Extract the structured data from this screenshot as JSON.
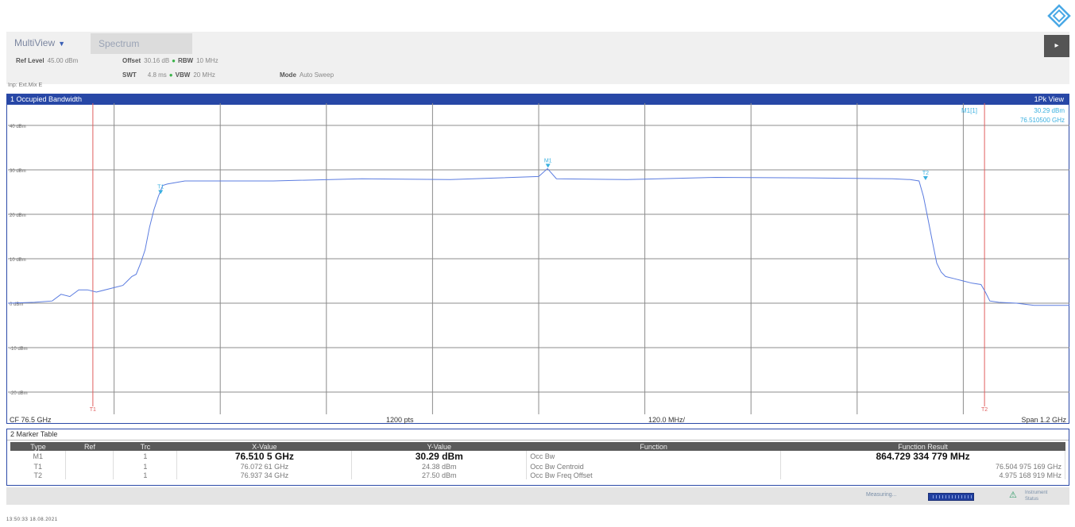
{
  "header": {
    "tab_multiview": "MultiView",
    "tab_spectrum": "Spectrum",
    "ref_level_label": "Ref Level",
    "ref_level_value": "45.00 dBm",
    "offset_label": "Offset",
    "offset_value": "30.16 dB",
    "rbw_label": "RBW",
    "rbw_value": "10 MHz",
    "swt_label": "SWT",
    "swt_value": "4.8 ms",
    "vbw_label": "VBW",
    "vbw_value": "20 MHz",
    "mode_label": "Mode",
    "mode_value": "Auto Sweep",
    "sub_label": "Inp: Ext.Mix E"
  },
  "window1": {
    "title": "1 Occupied Bandwidth",
    "view": "1Pk View",
    "marker_readout_name": "M1[1]",
    "marker_readout_level": "30.29 dBm",
    "marker_readout_freq": "76.510500 GHz"
  },
  "axis": {
    "y_ticks": [
      "40 dBm",
      "30 dBm",
      "20 dBm",
      "10 dBm",
      "0 dBm",
      "-10 dBm",
      "-20 dBm"
    ],
    "cf": "CF 76.5 GHz",
    "points": "1200 pts",
    "div": "120.0 MHz/",
    "span": "Span 1.2 GHz"
  },
  "chart_data": {
    "type": "line",
    "xlabel": "",
    "ylabel": "",
    "xlim": [
      75.9,
      77.1
    ],
    "ylim": [
      -25,
      45
    ],
    "y_ticks": [
      40,
      30,
      20,
      10,
      0,
      -10,
      -20
    ],
    "grid": true,
    "series": [
      {
        "x": [
          75.9,
          75.93,
          75.95,
          75.96,
          75.97,
          75.98,
          75.99,
          76.0,
          76.02,
          76.03,
          76.035,
          76.04,
          76.045,
          76.05,
          76.055,
          76.06,
          76.065,
          76.07,
          76.075,
          76.08,
          76.1,
          76.2,
          76.3,
          76.4,
          76.5,
          76.51,
          76.52,
          76.6,
          76.7,
          76.8,
          76.9,
          76.92,
          76.93,
          76.935,
          76.94,
          76.945,
          76.95,
          76.955,
          76.96,
          76.97,
          76.98,
          76.99,
          77.0,
          77.005,
          77.01,
          77.02,
          77.04,
          77.06,
          77.1
        ],
        "y": [
          0.0,
          0.2,
          0.5,
          2.0,
          1.5,
          3.0,
          3.0,
          2.5,
          3.5,
          4.0,
          5.0,
          6.0,
          6.5,
          9.0,
          12.0,
          17.0,
          21.0,
          24.0,
          26.5,
          26.8,
          27.5,
          27.5,
          28.0,
          27.8,
          28.5,
          30.29,
          28.0,
          27.8,
          28.3,
          28.2,
          28.0,
          27.8,
          27.5,
          24.0,
          19.0,
          14.0,
          9.0,
          7.0,
          6.0,
          5.5,
          5.0,
          4.5,
          4.2,
          2.5,
          0.5,
          0.2,
          0.0,
          -0.5,
          -0.5
        ]
      }
    ],
    "markers": [
      {
        "name": "M1",
        "x": 76.5105,
        "y": 30.29
      },
      {
        "name": "T1",
        "x": 76.07261,
        "y": 24.38
      },
      {
        "name": "T2",
        "x": 76.93734,
        "y": 27.5
      }
    ],
    "vertical_lines": [
      {
        "name": "T1",
        "x": 75.996
      },
      {
        "name": "T2",
        "x": 77.004
      }
    ]
  },
  "marker_table": {
    "title": "2 Marker Table",
    "headers": [
      "Type",
      "Ref",
      "Trc",
      "X-Value",
      "Y-Value",
      "Function",
      "Function Result"
    ],
    "rows": [
      {
        "type": "M1",
        "ref": "",
        "trc": "1",
        "x": "76.510 5 GHz",
        "y": "30.29 dBm",
        "function": "Occ Bw",
        "result": "864.729 334 779 MHz"
      },
      {
        "type": "T1",
        "ref": "",
        "trc": "1",
        "x": "76.072 61 GHz",
        "y": "24.38 dBm",
        "function": "Occ Bw Centroid",
        "result": "76.504 975 169 GHz"
      },
      {
        "type": "T2",
        "ref": "",
        "trc": "1",
        "x": "76.937 34 GHz",
        "y": "27.50 dBm",
        "function": "Occ Bw Freq Offset",
        "result": "4.975 168 919 MHz"
      }
    ]
  },
  "statusbar": {
    "measuring_label": "Measuring...",
    "status_text_1": "Instrument",
    "status_text_2": "Status"
  },
  "timestamp": "13:50:33  18.08.2021",
  "colors": {
    "trace": "#5b7ce0",
    "grid": "#8c8c8c",
    "limit_lines": "#e06060",
    "title_bar": "#2747a6"
  }
}
